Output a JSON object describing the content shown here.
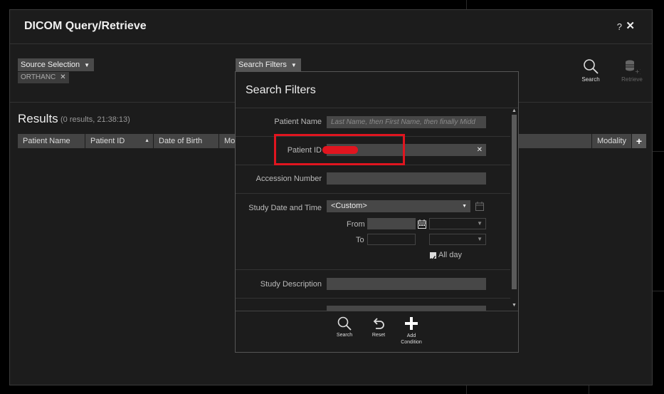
{
  "dialog": {
    "title": "DICOM Query/Retrieve",
    "help_label": "?",
    "close_label": "✕"
  },
  "toolbar": {
    "source_selection_label": "Source Selection",
    "source_chip_label": "ORTHANC",
    "search_filters_label": "Search Filters",
    "search_label": "Search",
    "retrieve_label": "Retrieve"
  },
  "results": {
    "title": "Results",
    "meta": "(0 results, 21:38:13)",
    "columns": [
      "Patient Name",
      "Patient ID",
      "Date of Birth",
      "Mo",
      "Modality"
    ],
    "sort_indicator": "▲",
    "add_column_label": "+"
  },
  "search_panel": {
    "title": "Search Filters",
    "patient_name_label": "Patient Name",
    "patient_name_placeholder": "Last Name, then First Name, then finally Midd",
    "patient_id_label": "Patient ID",
    "patient_id_clear": "✕",
    "accession_label": "Accession Number",
    "study_date_label": "Study Date and Time",
    "study_date_value": "<Custom>",
    "from_label": "From",
    "to_label": "To",
    "all_day_label": "All day",
    "study_description_label": "Study Description",
    "tools": {
      "search_label": "Search",
      "reset_label": "Reset",
      "add_condition_label": "Add\nCondition"
    }
  },
  "colors": {
    "redaction": "#e0151f",
    "background": "#1c1c1c"
  }
}
